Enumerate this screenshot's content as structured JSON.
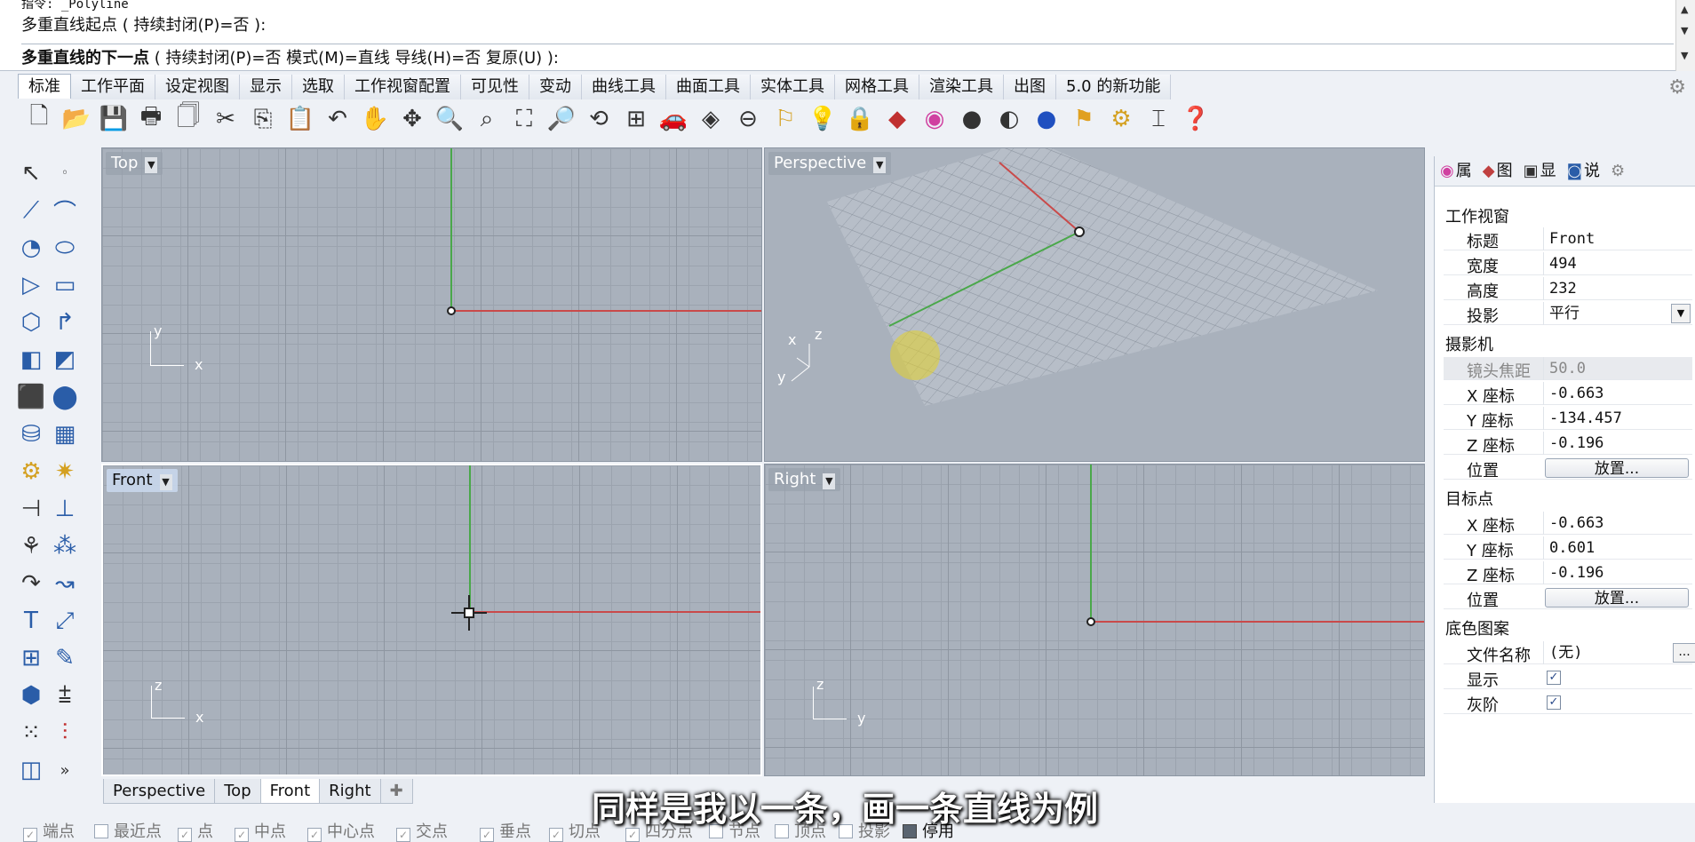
{
  "command": {
    "line1": "指令: _Polyline",
    "line2": "多重直线起点 ( 持续封闭(P)=否 ):",
    "prompt_bold": "多重直线的下一点",
    "prompt_rest": "( 持续封闭(P)=否  模式(M)=直线  导线(H)=否  复原(U) ):"
  },
  "tabs": [
    "标准",
    "工作平面",
    "设定视图",
    "显示",
    "选取",
    "工作视窗配置",
    "可见性",
    "变动",
    "曲线工具",
    "曲面工具",
    "实体工具",
    "网格工具",
    "渲染工具",
    "出图",
    "5.0 的新功能"
  ],
  "viewports": {
    "top": "Top",
    "perspective": "Perspective",
    "front": "Front",
    "right": "Right"
  },
  "axis_labels": {
    "top": [
      "y",
      "x"
    ],
    "perspective": [
      "x",
      "z",
      "y"
    ],
    "front": [
      "z",
      "x"
    ],
    "right": [
      "z",
      "y"
    ]
  },
  "viewport_tabs": [
    "Perspective",
    "Top",
    "Front",
    "Right"
  ],
  "add_viewport_glyph": "✚",
  "panel": {
    "tabs": [
      "属",
      "图",
      "显",
      "说"
    ],
    "section_viewport": "工作视窗",
    "title_label": "标题",
    "title_value": "Front",
    "width_label": "宽度",
    "width_value": "494",
    "height_label": "高度",
    "height_value": "232",
    "projection_label": "投影",
    "projection_value": "平行",
    "section_camera": "摄影机",
    "lens_label": "镜头焦距",
    "lens_value": "50.0",
    "cam_x_label": "X 座标",
    "cam_x_value": "-0.663",
    "cam_y_label": "Y 座标",
    "cam_y_value": "-134.457",
    "cam_z_label": "Z 座标",
    "cam_z_value": "-0.196",
    "cam_pos_label": "位置",
    "place_button": "放置...",
    "section_target": "目标点",
    "tgt_x_label": "X 座标",
    "tgt_x_value": "-0.663",
    "tgt_y_label": "Y 座标",
    "tgt_y_value": "0.601",
    "tgt_z_label": "Z 座标",
    "tgt_z_value": "-0.196",
    "tgt_pos_label": "位置",
    "section_background": "底色图案",
    "file_label": "文件名称",
    "file_value": "(无)",
    "show_label": "显示",
    "show_checked": true,
    "gray_label": "灰阶",
    "gray_checked": true,
    "more_button": "..."
  },
  "osnaps": [
    {
      "label": "端点",
      "checked": true
    },
    {
      "label": "最近点",
      "checked": false
    },
    {
      "label": "点",
      "checked": true
    },
    {
      "label": "中点",
      "checked": true
    },
    {
      "label": "中心点",
      "checked": true
    },
    {
      "label": "交点",
      "checked": true
    },
    {
      "label": "垂点",
      "checked": true
    },
    {
      "label": "切点",
      "checked": true
    },
    {
      "label": "四分点",
      "checked": true
    },
    {
      "label": "节点",
      "checked": false
    },
    {
      "label": "顶点",
      "checked": false
    },
    {
      "label": "投影",
      "checked": false
    },
    {
      "label": "停用",
      "checked": false
    }
  ],
  "subtitle": "同样是我以一条，画一条直线为例",
  "colors": {
    "x_axis": "#c94a4a",
    "y_axis": "#4aa84a",
    "viewport_bg": "#a9b1bc"
  }
}
